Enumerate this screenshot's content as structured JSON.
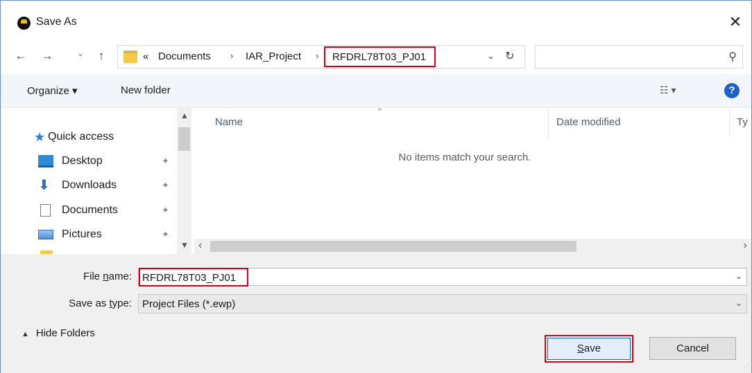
{
  "window": {
    "title": "Save As",
    "close_label": "✕"
  },
  "nav": {
    "back_label": "←",
    "forward_label": "→",
    "recent_label": "⌄",
    "up_label": "↑"
  },
  "address": {
    "overflow": "«",
    "crumbs": [
      "Documents",
      "IAR_Project"
    ],
    "separator": "›",
    "current": "RFDRL78T03_PJ01",
    "dropdown_label": "⌄",
    "refresh_label": "↻"
  },
  "search": {
    "placeholder": "",
    "icon_label": "⚲"
  },
  "toolbar": {
    "organize_label": "Organize ▾",
    "new_folder_label": "New folder",
    "view_label": "☷ ▾",
    "help_label": "?"
  },
  "sidebar": {
    "items": [
      {
        "label": "Quick access",
        "icon": "star-icon"
      },
      {
        "label": "Desktop",
        "icon": "desktop-icon",
        "pinned": true
      },
      {
        "label": "Downloads",
        "icon": "download-icon",
        "pinned": true
      },
      {
        "label": "Documents",
        "icon": "documents-icon",
        "pinned": true
      },
      {
        "label": "Pictures",
        "icon": "pictures-icon",
        "pinned": true
      }
    ],
    "pin_label": "📌"
  },
  "filelist": {
    "columns": [
      "Name",
      "Date modified",
      "Ty"
    ],
    "empty_message": "No items match your search."
  },
  "form": {
    "filename_label_pre": "File ",
    "filename_label_ul": "n",
    "filename_label_post": "ame:",
    "filename_value": "RFDRL78T03_PJ01",
    "type_label_pre": "Save as ",
    "type_label_ul": "t",
    "type_label_post": "ype:",
    "type_value": "Project Files (*.ewp)"
  },
  "footer": {
    "hide_folders_label": "Hide Folders",
    "save_label_ul": "S",
    "save_label_rest": "ave",
    "cancel_label": "Cancel"
  },
  "colors": {
    "highlight_border": "#d4001a",
    "accent_blue": "#0a64c8"
  }
}
